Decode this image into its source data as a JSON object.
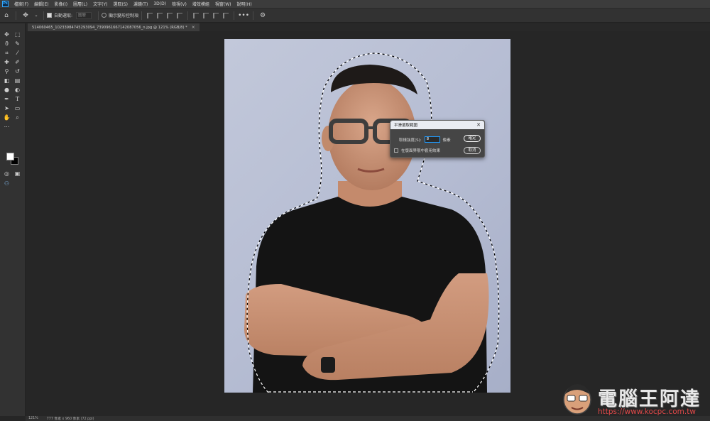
{
  "menubar": {
    "logo": "Ps",
    "items": [
      "檔案(F)",
      "編輯(E)",
      "影像(I)",
      "圖層(L)",
      "文字(Y)",
      "選取(S)",
      "濾鏡(T)",
      "3D(D)",
      "檢視(V)",
      "增效模組",
      "視窗(W)",
      "說明(H)"
    ]
  },
  "options": {
    "auto_select_label": "自動選取:",
    "auto_select_value": "圖層",
    "show_transform_label": "顯示變形控制項"
  },
  "document": {
    "tab_title": "514060465_10233984745293094_7390961667142087056_n.jpg @ 121% (RGB/8) *",
    "close_glyph": "×"
  },
  "dialog": {
    "title": "平滑選取範圍",
    "close_glyph": "✕",
    "radius_label": "取樣強度(S):",
    "radius_value": "8",
    "radius_unit": "像素",
    "apply_canvas_label": "在版面界限中套用效果",
    "ok_label": "確定",
    "cancel_label": "取消"
  },
  "status": {
    "zoom": "121%",
    "doc_size": "777 像素 x 960 像素 (72 ppi)"
  },
  "watermark": {
    "brand": "電腦王阿達",
    "url": "https://www.kocpc.com.tw"
  },
  "colors": {
    "foreground": "#ffffff",
    "background": "#000000",
    "accent": "#31a8ff",
    "watermark_red": "#e04848"
  },
  "tools": [
    "move-icon",
    "marquee-icon",
    "lasso-icon",
    "quick-select-icon",
    "crop-icon",
    "eyedropper-icon",
    "healing-icon",
    "brush-icon",
    "clone-stamp-icon",
    "history-brush-icon",
    "eraser-icon",
    "gradient-icon",
    "blur-icon",
    "dodge-icon",
    "pen-icon",
    "type-icon",
    "path-select-icon",
    "shape-icon",
    "hand-icon",
    "zoom-icon",
    "more-icon"
  ]
}
